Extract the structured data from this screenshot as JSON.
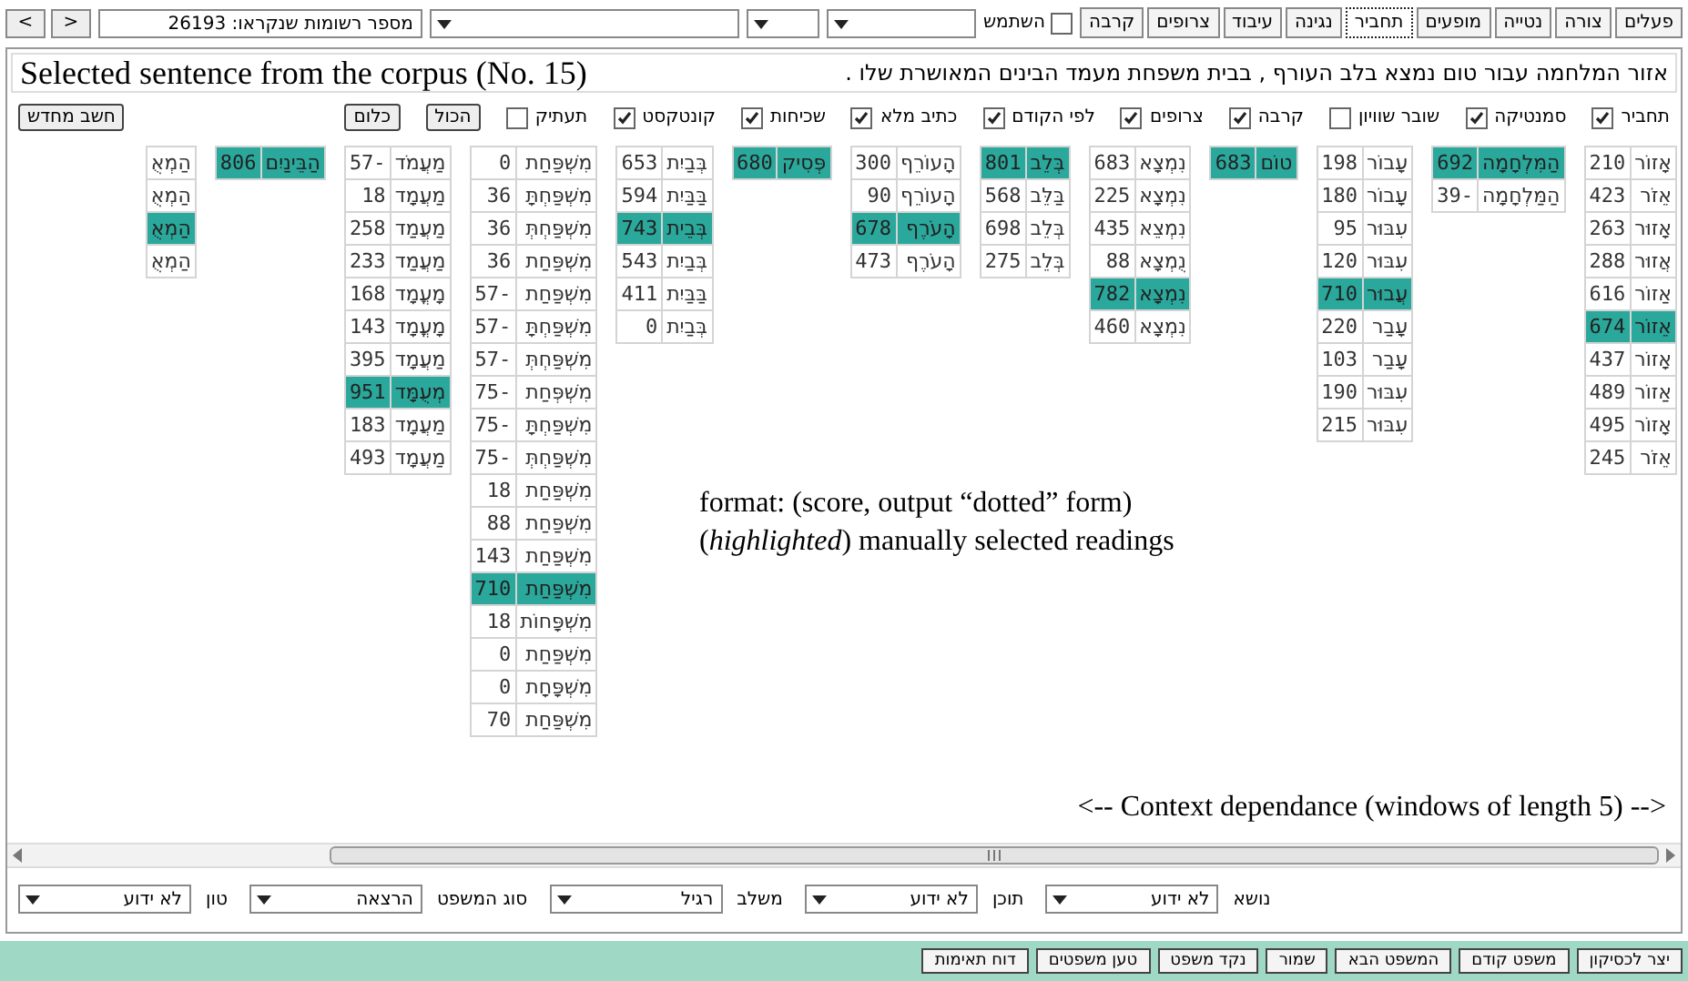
{
  "nav_buttons": [
    ">",
    "<"
  ],
  "records_field": {
    "value": "מספר רשומות שנקראו: 26193"
  },
  "dropdowns": [
    {
      "kind": "select"
    },
    {
      "kind": "select"
    },
    {
      "kind": "select"
    }
  ],
  "use_checkbox": {
    "label": "השתמש",
    "checked": false
  },
  "tabs": [
    {
      "label": "פעלים",
      "selected": false
    },
    {
      "label": "צורה",
      "selected": false
    },
    {
      "label": "נטייה",
      "selected": false
    },
    {
      "label": "מופעים",
      "selected": false
    },
    {
      "label": "תחביר",
      "selected": true
    },
    {
      "label": "נגינה",
      "selected": false
    },
    {
      "label": "עיבוד",
      "selected": false
    },
    {
      "label": "צרופים",
      "selected": false
    },
    {
      "label": "קרבה",
      "selected": false
    }
  ],
  "sentence": "אזור המלחמה עבור טום נמצא בלב העורף , בבית משפחת מעמד הבינים המאושרת שלו .",
  "sentence_annotation": "Selected sentence from the corpus (No. 15)",
  "options": [
    {
      "label": "תחביר",
      "checked": true
    },
    {
      "label": "סמנטיקה",
      "checked": true
    },
    {
      "label": "שובר שוויון",
      "checked": false
    },
    {
      "label": "קרבה",
      "checked": true
    },
    {
      "label": "צרופים",
      "checked": true
    },
    {
      "label": "לפי הקודם",
      "checked": true
    },
    {
      "label": "כתיב מלא",
      "checked": true
    },
    {
      "label": "שכיחות",
      "checked": true
    },
    {
      "label": "קונטקסט",
      "checked": true
    },
    {
      "label": "תעתיק",
      "checked": false
    }
  ],
  "select_buttons": [
    "הכול",
    "כלום"
  ],
  "recalc_button": "חשב מחדש",
  "words": [
    {
      "readings": [
        {
          "form": "אָזוֹר",
          "score": "210",
          "selected": false
        },
        {
          "form": "אֵזֹר",
          "score": "423",
          "selected": false
        },
        {
          "form": "אָזוּר",
          "score": "263",
          "selected": false
        },
        {
          "form": "אֲזוּר",
          "score": "288",
          "selected": false
        },
        {
          "form": "אַזוֹר",
          "score": "616",
          "selected": false
        },
        {
          "form": "אֵזוֹר",
          "score": "674",
          "selected": true
        },
        {
          "form": "אָזוֹר",
          "score": "437",
          "selected": false
        },
        {
          "form": "אַזוֹר",
          "score": "489",
          "selected": false
        },
        {
          "form": "אָזוֹר",
          "score": "495",
          "selected": false
        },
        {
          "form": "אֵזֹר",
          "score": "245",
          "selected": false
        }
      ]
    },
    {
      "readings": [
        {
          "form": "הַמִּלְחָמָה",
          "score": "692",
          "selected": true
        },
        {
          "form": "הַמַּלְחָמָה",
          "score": "39-",
          "selected": false
        }
      ]
    },
    {
      "readings": [
        {
          "form": "עָבוֹר",
          "score": "198",
          "selected": false
        },
        {
          "form": "עָבוֹר",
          "score": "180",
          "selected": false
        },
        {
          "form": "עִבּוּר",
          "score": "95",
          "selected": false
        },
        {
          "form": "עִבּוּר",
          "score": "120",
          "selected": false
        },
        {
          "form": "עֲבוּר",
          "score": "710",
          "selected": true
        },
        {
          "form": "עָבַר",
          "score": "220",
          "selected": false
        },
        {
          "form": "עָבַר",
          "score": "103",
          "selected": false
        },
        {
          "form": "עִבּוּר",
          "score": "190",
          "selected": false
        },
        {
          "form": "עִבּוּר",
          "score": "215",
          "selected": false
        }
      ]
    },
    {
      "readings": [
        {
          "form": "טוֹם",
          "score": "683",
          "selected": true
        }
      ]
    },
    {
      "readings": [
        {
          "form": "נִמְצָא",
          "score": "683",
          "selected": false
        },
        {
          "form": "נִמְצָא",
          "score": "225",
          "selected": false
        },
        {
          "form": "נִמְצֵא",
          "score": "435",
          "selected": false
        },
        {
          "form": "נֻמְצָא",
          "score": "88",
          "selected": false
        },
        {
          "form": "נִמְצָא",
          "score": "782",
          "selected": true
        },
        {
          "form": "נִמְצָא",
          "score": "460",
          "selected": false
        }
      ]
    },
    {
      "readings": [
        {
          "form": "בְּלֵב",
          "score": "801",
          "selected": true
        },
        {
          "form": "בַּלֵּב",
          "score": "568",
          "selected": false
        },
        {
          "form": "בְּלֵב",
          "score": "698",
          "selected": false
        },
        {
          "form": "בְּלֵב",
          "score": "275",
          "selected": false
        }
      ]
    },
    {
      "readings": [
        {
          "form": "הָעוֹרֵף",
          "score": "300",
          "selected": false
        },
        {
          "form": "הָעוֹרֵף",
          "score": "90",
          "selected": false
        },
        {
          "form": "הָעֹרֶף",
          "score": "678",
          "selected": true
        },
        {
          "form": "הָעֹרֶף",
          "score": "473",
          "selected": false
        }
      ]
    },
    {
      "readings": [
        {
          "form": "פְּסִיק",
          "score": "680",
          "selected": true
        }
      ]
    },
    {
      "readings": [
        {
          "form": "בְּבַיִת",
          "score": "653",
          "selected": false
        },
        {
          "form": "בַּבַּיִת",
          "score": "594",
          "selected": false
        },
        {
          "form": "בְּבֵית",
          "score": "743",
          "selected": true
        },
        {
          "form": "בְּבַיִת",
          "score": "543",
          "selected": false
        },
        {
          "form": "בַּבַּיִת",
          "score": "411",
          "selected": false
        },
        {
          "form": "בְּבַיִת",
          "score": "0",
          "selected": false
        }
      ]
    },
    {
      "readings": [
        {
          "form": "מִשְׁפַּחַת",
          "score": "0",
          "selected": false
        },
        {
          "form": "מִשְׁפַּחְתָּ",
          "score": "36",
          "selected": false
        },
        {
          "form": "מִשְׁפַּחְתְּ",
          "score": "36",
          "selected": false
        },
        {
          "form": "מִשְׁפַּחַת",
          "score": "36",
          "selected": false
        },
        {
          "form": "מִשְׁפַּחַת",
          "score": "57-",
          "selected": false
        },
        {
          "form": "מִשְׁפַּחְתָּ",
          "score": "57-",
          "selected": false
        },
        {
          "form": "מִשְׁפַּחְתְּ",
          "score": "57-",
          "selected": false
        },
        {
          "form": "מִשְׁפְּחַת",
          "score": "75-",
          "selected": false
        },
        {
          "form": "מִשְׁפַּחְתָּ",
          "score": "75-",
          "selected": false
        },
        {
          "form": "מִשְׁפַּחְתְּ",
          "score": "75-",
          "selected": false
        },
        {
          "form": "מִשְׁפַּחַת",
          "score": "18",
          "selected": false
        },
        {
          "form": "מִשְׁפַּחַת",
          "score": "88",
          "selected": false
        },
        {
          "form": "מִשְׁפַּחַת",
          "score": "143",
          "selected": false
        },
        {
          "form": "מִשְׁפַּחַת",
          "score": "710",
          "selected": true
        },
        {
          "form": "מִשְׁפָּחוֹת",
          "score": "18",
          "selected": false
        },
        {
          "form": "מִשְׁפַּחַת",
          "score": "0",
          "selected": false
        },
        {
          "form": "מִשְׁפָּחָת",
          "score": "0",
          "selected": false
        },
        {
          "form": "מִשְׁפַּחַת",
          "score": "70",
          "selected": false
        }
      ]
    },
    {
      "readings": [
        {
          "form": "מַעֲמֹד",
          "score": "57-",
          "selected": false
        },
        {
          "form": "מַעֲמָד",
          "score": "18",
          "selected": false
        },
        {
          "form": "מַעֲמַד",
          "score": "258",
          "selected": false
        },
        {
          "form": "מַעֲמַד",
          "score": "233",
          "selected": false
        },
        {
          "form": "מָעֳמָד",
          "score": "168",
          "selected": false
        },
        {
          "form": "מָעֳמָד",
          "score": "143",
          "selected": false
        },
        {
          "form": "מַעֲמָד",
          "score": "395",
          "selected": false
        },
        {
          "form": "מְעֻמָּד",
          "score": "951",
          "selected": true
        },
        {
          "form": "מַעֲמָד",
          "score": "183",
          "selected": false
        },
        {
          "form": "מַעֲמָד",
          "score": "493",
          "selected": false
        }
      ]
    },
    {
      "readings": [
        {
          "form": "הַבֵּינַיִם",
          "score": "806",
          "selected": true
        }
      ]
    },
    {
      "readings": [
        {
          "form": "הַמְאֻ",
          "selected": false
        },
        {
          "form": "הַמְאֻ",
          "selected": false
        },
        {
          "form": "הַמְאֻ",
          "selected": true
        },
        {
          "form": "הַמְאֻ",
          "selected": false
        }
      ]
    }
  ],
  "legend": {
    "format": "format: (score, output “dotted” form)",
    "highlight": "(*highlighted*) manually selected readings"
  },
  "context_note": "<-- Context dependance (windows of length 5) -->",
  "properties": [
    {
      "label": "נושא",
      "value": "לא ידוע"
    },
    {
      "label": "תוכן",
      "value": "לא ידוע"
    },
    {
      "label": "משלב",
      "value": "רגיל"
    },
    {
      "label": "סוג המשפט",
      "value": "הרצאה"
    },
    {
      "label": "טון",
      "value": "לא ידוע"
    }
  ],
  "action_buttons": [
    "יצר לכסיקון",
    "משפט קודם",
    "המשפט הבא",
    "שמור",
    "נקד משפט",
    "טען משפטים",
    "דוח תאימות"
  ]
}
